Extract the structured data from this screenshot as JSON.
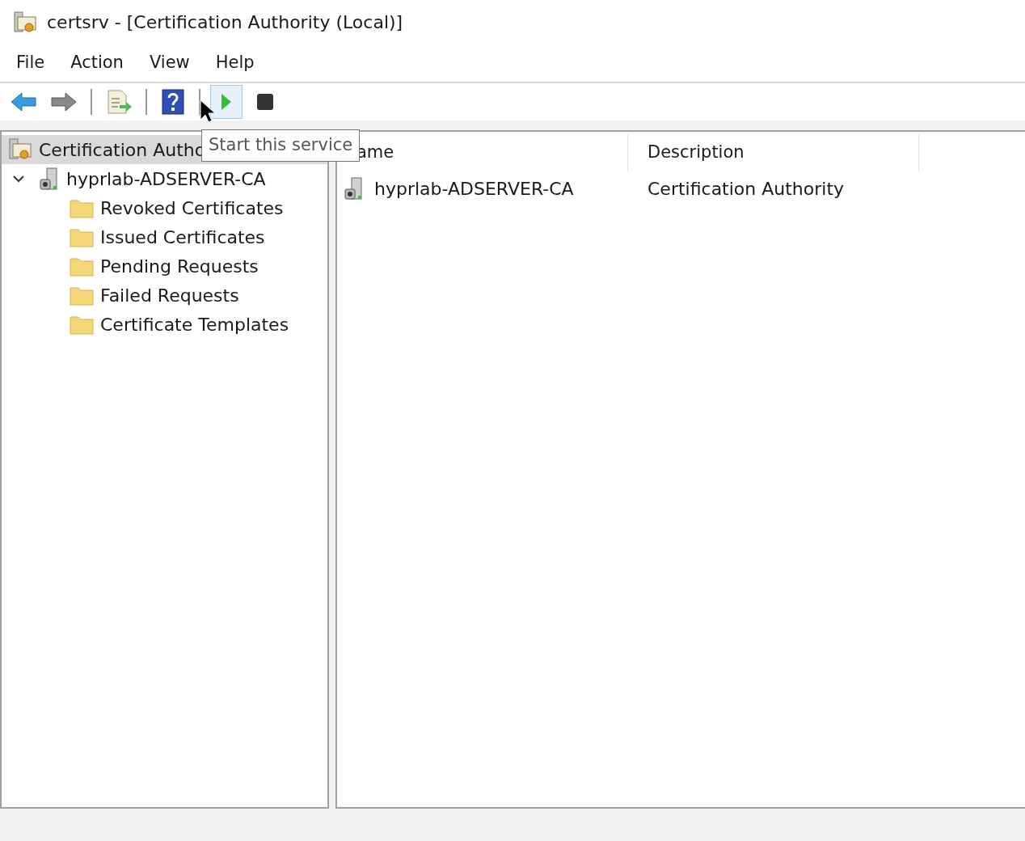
{
  "window": {
    "title": "certsrv - [Certification Authority (Local)]"
  },
  "menu": [
    "File",
    "Action",
    "View",
    "Help"
  ],
  "toolbar": [
    {
      "kind": "back",
      "hovered": false
    },
    {
      "kind": "forward",
      "hovered": false
    },
    {
      "kind": "separator"
    },
    {
      "kind": "export",
      "hovered": false
    },
    {
      "kind": "separator"
    },
    {
      "kind": "help",
      "hovered": false
    },
    {
      "kind": "separator"
    },
    {
      "kind": "start",
      "hovered": true
    },
    {
      "kind": "stop",
      "hovered": false
    }
  ],
  "tooltip": "Start this service",
  "tree": {
    "label": "Certification Autho",
    "selected": true,
    "children": [
      {
        "label": "hyprlab-ADSERVER-CA",
        "selected": false,
        "expanded": true,
        "children": [
          {
            "label": "Revoked Certificates",
            "selected": false
          },
          {
            "label": "Issued Certificates",
            "selected": false
          },
          {
            "label": "Pending Requests",
            "selected": false
          },
          {
            "label": "Failed Requests",
            "selected": false
          },
          {
            "label": "Certificate Templates",
            "selected": false
          }
        ]
      }
    ]
  },
  "table": {
    "columns": [
      "ame",
      "Description"
    ],
    "rows": [
      {
        "name": "hyprlab-ADSERVER-CA",
        "description": "Certification Authority"
      }
    ]
  }
}
